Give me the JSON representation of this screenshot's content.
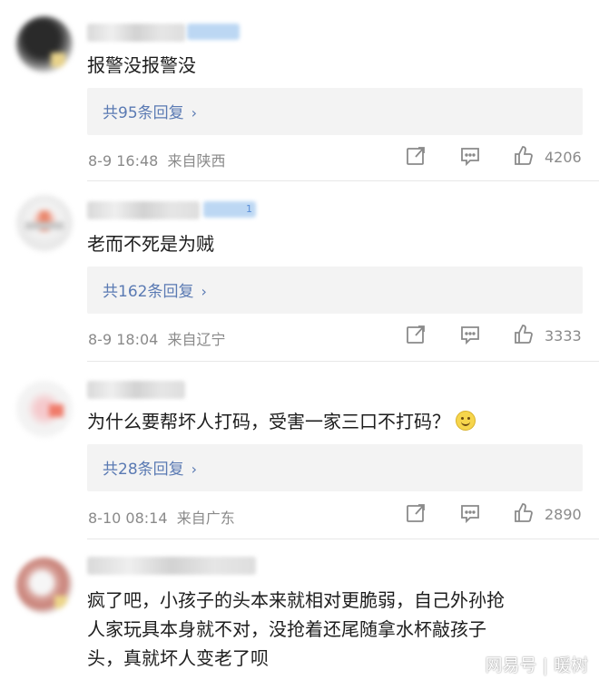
{
  "comments": [
    {
      "text": "报警没报警没",
      "replies": "共95条回复",
      "time": "8-9 16:48",
      "location": "来自陕西",
      "likes": "4206"
    },
    {
      "text": "老而不死是为贼",
      "replies": "共162条回复",
      "time": "8-9 18:04",
      "location": "来自辽宁",
      "likes": "3333",
      "badge": "1"
    },
    {
      "text": "为什么要帮坏人打码，受害一家三口不打码？",
      "emoji": "smile-emoji",
      "replies": "共28条回复",
      "time": "8-10 08:14",
      "location": "来自广东",
      "likes": "2890"
    },
    {
      "text_lines": [
        "疯了吧，小孩子的头本来就相对更脆弱，自己外孙抢",
        "人家玩具本身就不对，没抢着还尾随拿水杯敲孩子",
        "头，真就坏人变老了呗"
      ]
    }
  ],
  "icons": {
    "share": "share-icon",
    "comment": "comment-icon",
    "like": "like-icon",
    "reply_chevron": "chevron-right-icon"
  },
  "watermark": "网易号 | 暖树",
  "colors": {
    "reply_link": "#5a7ab3",
    "meta_gray": "#8a8a8a",
    "reply_bg": "#f3f3f3"
  }
}
